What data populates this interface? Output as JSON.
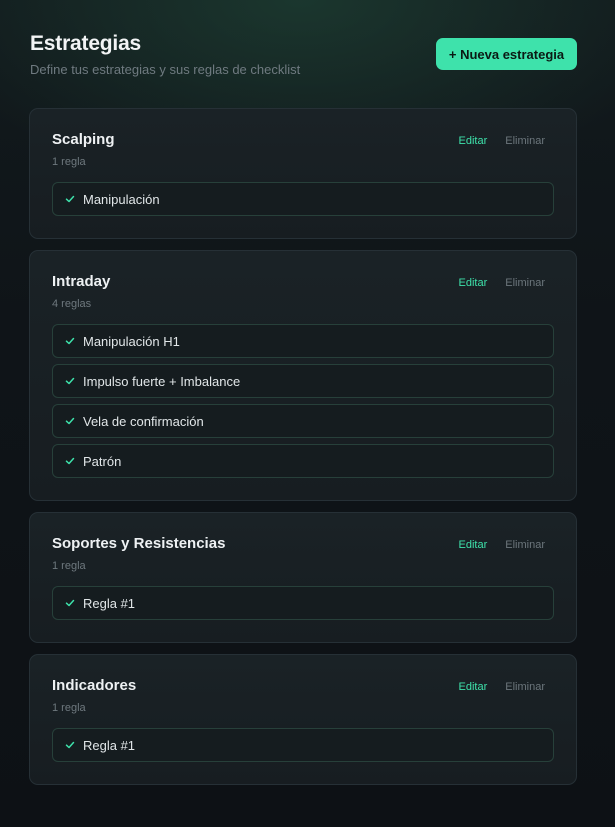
{
  "header": {
    "title": "Estrategias",
    "subtitle": "Define tus estrategias y sus reglas de checklist",
    "new_button_label": "+ Nueva estrategia"
  },
  "colors": {
    "accent": "#3ee2ab",
    "background": "#0f1418",
    "card": "#1a2226"
  },
  "icons": {
    "rule_check": "check-icon"
  },
  "strategies": [
    {
      "name": "Scalping",
      "count": "1 regla",
      "edit_label": "Editar",
      "delete_label": "Eliminar",
      "rules": [
        "Manipulación"
      ]
    },
    {
      "name": "Intraday",
      "count": "4 reglas",
      "edit_label": "Editar",
      "delete_label": "Eliminar",
      "rules": [
        "Manipulación H1",
        "Impulso fuerte + Imbalance",
        "Vela de confirmación",
        "Patrón"
      ]
    },
    {
      "name": "Soportes y Resistencias",
      "count": "1 regla",
      "edit_label": "Editar",
      "delete_label": "Eliminar",
      "rules": [
        "Regla #1"
      ]
    },
    {
      "name": "Indicadores",
      "count": "1 regla",
      "edit_label": "Editar",
      "delete_label": "Eliminar",
      "rules": [
        "Regla #1"
      ]
    }
  ]
}
